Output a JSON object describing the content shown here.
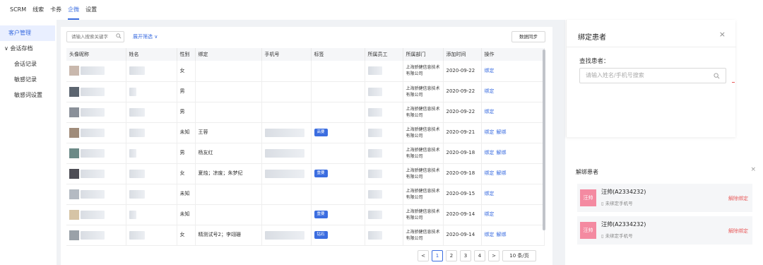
{
  "topnav": {
    "items": [
      "SCRM",
      "线索",
      "卡券",
      "企微",
      "设置"
    ]
  },
  "sidebar": {
    "active": "客户管理",
    "group": "会话存档",
    "subs": [
      "会话记录",
      "敏感记录",
      "敏感词设置"
    ]
  },
  "toolbar": {
    "search_placeholder": "请输入搜索关键字",
    "filter": "展开筛选",
    "sync": "数据同步"
  },
  "table": {
    "headers": [
      "头像昵称",
      "姓名",
      "性别",
      "绑定",
      "手机号",
      "标签",
      "所属员工",
      "所属部门",
      "添加时间",
      "操作"
    ],
    "rows": [
      {
        "gender": "女",
        "bind": "",
        "tag": "",
        "dept": "上海骄健信息技术有限公司",
        "date": "2020-09-22",
        "ops": [
          "绑定"
        ]
      },
      {
        "gender": "男",
        "bind": "",
        "tag": "",
        "dept": "上海骄健信息技术有限公司",
        "date": "2020-09-22",
        "ops": [
          "绑定"
        ]
      },
      {
        "gender": "男",
        "bind": "",
        "tag": "",
        "dept": "上海骄健信息技术有限公司",
        "date": "2020-09-22",
        "ops": [
          "绑定"
        ]
      },
      {
        "gender": "未知",
        "bind": "王蓉",
        "tag": "高要",
        "dept": "上海骄健信息技术有限公司",
        "date": "2020-09-21",
        "ops": [
          "绑定",
          "解绑"
        ]
      },
      {
        "gender": "男",
        "bind": "杨友红",
        "tag": "",
        "dept": "上海骄健信息技术有限公司",
        "date": "2020-09-18",
        "ops": [
          "绑定",
          "解绑"
        ]
      },
      {
        "gender": "女",
        "bind": "夏烛；凉废；朱梦纪",
        "tag": "重要",
        "dept": "上海骄健信息技术有限公司",
        "date": "2020-09-18",
        "ops": [
          "绑定",
          "解绑"
        ]
      },
      {
        "gender": "未知",
        "bind": "",
        "tag": "",
        "dept": "上海骄健信息技术有限公司",
        "date": "2020-09-15",
        "ops": [
          "绑定"
        ]
      },
      {
        "gender": "未知",
        "bind": "",
        "tag": "重要",
        "dept": "上海骄健信息技术有限公司",
        "date": "2020-09-14",
        "ops": [
          "绑定"
        ]
      },
      {
        "gender": "女",
        "bind": "精测试号2；李翊珊",
        "tag": "钻石",
        "dept": "上海骄健信息技术有限公司",
        "date": "2020-09-14",
        "ops": [
          "绑定",
          "解绑"
        ]
      }
    ]
  },
  "pager": {
    "prev": "<",
    "pages": [
      "1",
      "2",
      "3",
      "4"
    ],
    "next": ">",
    "size": "10 条/页"
  },
  "bind_dialog": {
    "title": "绑定患者",
    "close": "×",
    "label": "查找患者：",
    "placeholder": "请输入姓名/手机号搜索"
  },
  "unbind_panel": {
    "title": "解绑患者",
    "close": "×",
    "patients": [
      {
        "avatar": "汪帅",
        "name": "汪帅(A2334232)",
        "phone": "未绑定手机号",
        "action": "解除绑定"
      },
      {
        "avatar": "汪帅",
        "name": "汪帅(A2334232)",
        "phone": "未绑定手机号",
        "action": "解除绑定"
      }
    ]
  },
  "colors": {
    "accent": "#3b6de0",
    "danger": "#e85a5a",
    "avatar": "#f48aa1"
  }
}
